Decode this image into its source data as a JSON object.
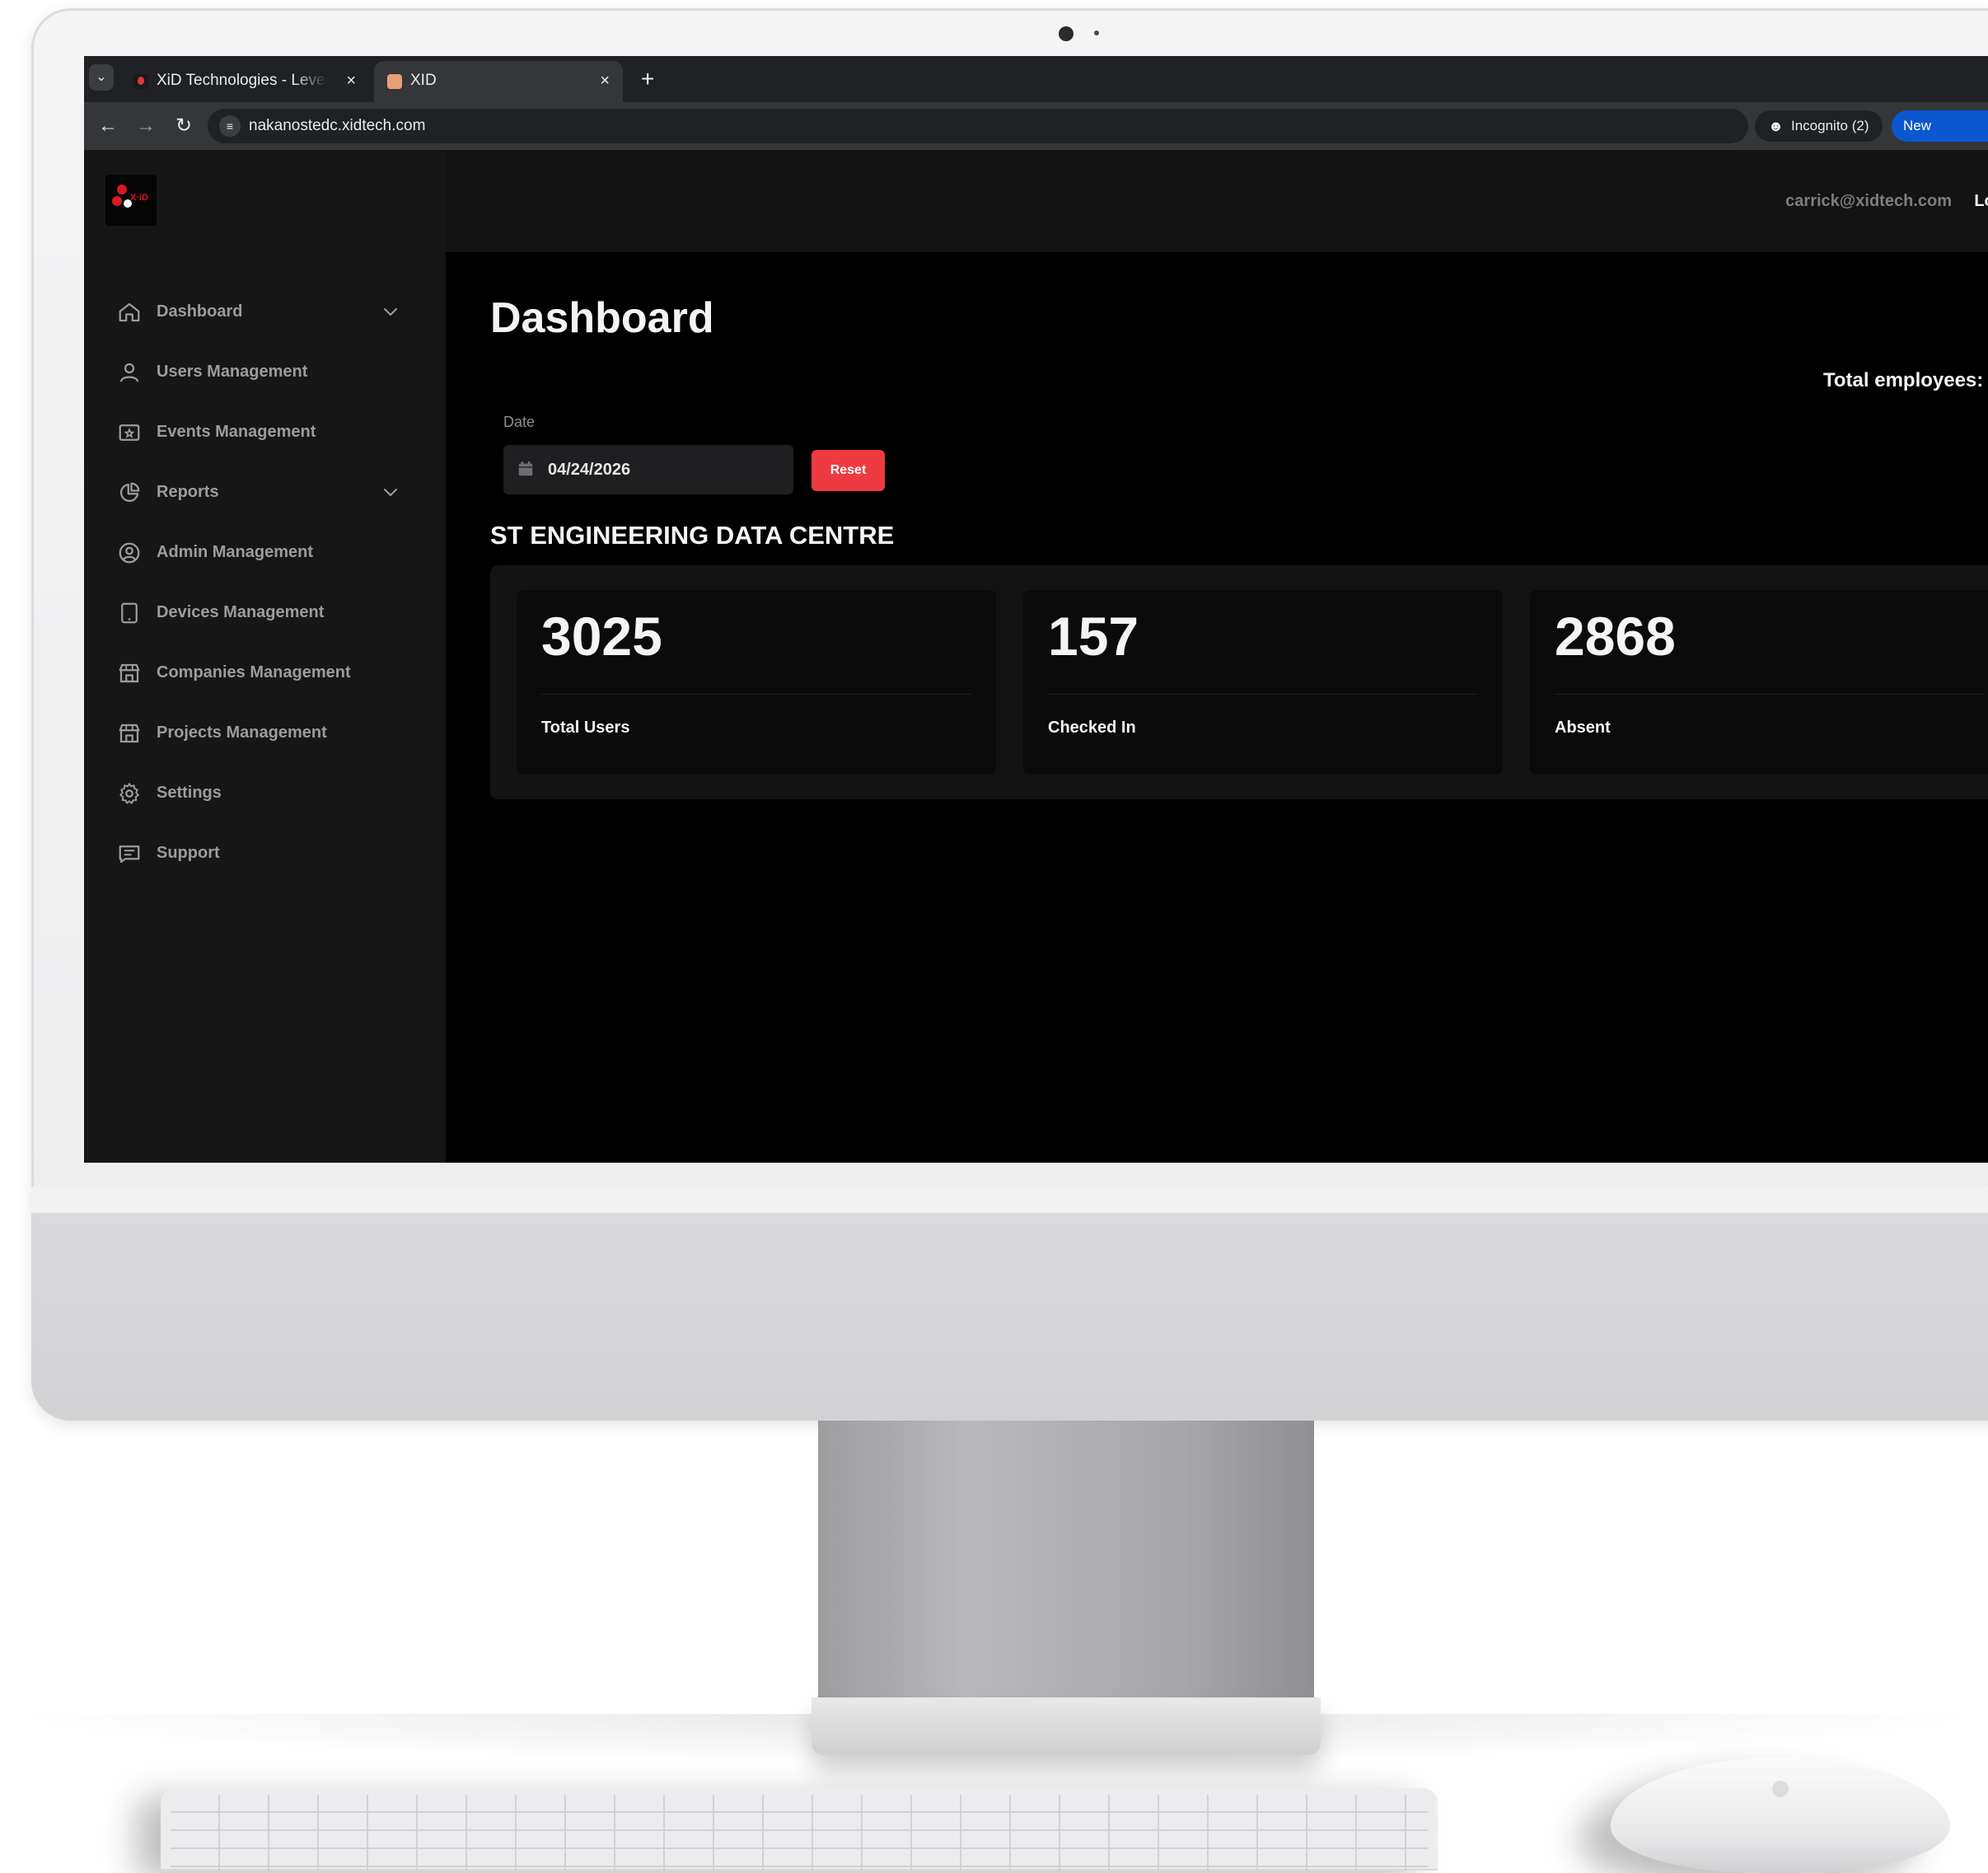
{
  "browser": {
    "tabs": [
      {
        "title": "XiD Technologies - Lever"
      },
      {
        "title": "XID"
      }
    ],
    "url": "nakanostedc.xidtech.com",
    "incognito_label": "Incognito (2)",
    "new_chrome_label": "New Chrome"
  },
  "app": {
    "user_email": "carrick@xidtech.com",
    "logout_label": "Log",
    "sidebar": {
      "items": [
        {
          "label": "Dashboard",
          "icon": "home-icon",
          "has_chevron": true
        },
        {
          "label": "Users Management",
          "icon": "user-icon",
          "has_chevron": false
        },
        {
          "label": "Events Management",
          "icon": "ticket-icon",
          "has_chevron": false
        },
        {
          "label": "Reports",
          "icon": "chart-pie-icon",
          "has_chevron": true
        },
        {
          "label": "Admin Management",
          "icon": "user-circle-icon",
          "has_chevron": false
        },
        {
          "label": "Devices Management",
          "icon": "tablet-icon",
          "has_chevron": false
        },
        {
          "label": "Companies Management",
          "icon": "building-store-icon",
          "has_chevron": false
        },
        {
          "label": "Projects Management",
          "icon": "building-store-icon",
          "has_chevron": false
        },
        {
          "label": "Settings",
          "icon": "gear-icon",
          "has_chevron": false
        },
        {
          "label": "Support",
          "icon": "message-icon",
          "has_chevron": false
        }
      ]
    },
    "main": {
      "title": "Dashboard",
      "total_employees_label": "Total employees:",
      "date_label": "Date",
      "date_value": "04/24/2026",
      "reset_label": "Reset",
      "section_title": "ST ENGINEERING DATA CENTRE",
      "stats": [
        {
          "value": "3025",
          "label": "Total Users"
        },
        {
          "value": "157",
          "label": "Checked In"
        },
        {
          "value": "2868",
          "label": "Absent"
        }
      ]
    }
  },
  "colors": {
    "accent_red": "#ee3b3f",
    "sidebar_bg": "#161617",
    "main_bg": "#000000",
    "chrome_blue": "#0b57d0"
  }
}
